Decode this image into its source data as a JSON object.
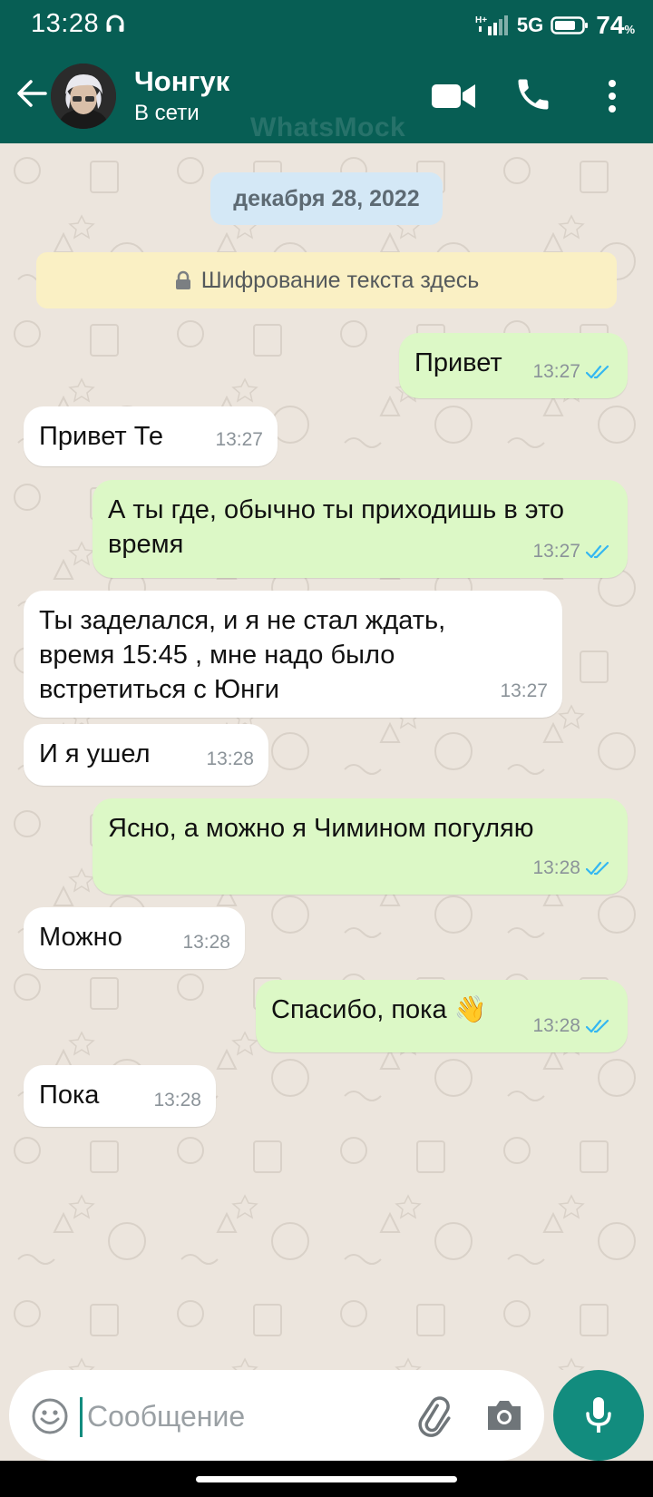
{
  "status_bar": {
    "time": "13:28",
    "network": "5G",
    "network_sub": "H+",
    "battery_pct": "74",
    "battery_pct_sign": "%"
  },
  "header": {
    "contact_name": "Чонгук",
    "contact_status": "В сети",
    "watermark": "WhatsMock"
  },
  "chat": {
    "date_chip": "декабря 28, 2022",
    "encryption_banner": "Шифрование текста здесь",
    "messages": [
      {
        "direction": "out",
        "lines": [
          "Привет"
        ],
        "time": "13:27",
        "read": true
      },
      {
        "direction": "in",
        "lines": [
          "Привет Те"
        ],
        "time": "13:27"
      },
      {
        "direction": "out",
        "lines": [
          "А ты где, обычно ты приходишь в это",
          "время"
        ],
        "time": "13:27",
        "read": true
      },
      {
        "direction": "in",
        "lines": [
          "Ты заделался, и я не стал ждать,",
          "время 15:45 , мне надо было",
          "встретиться с Юнги"
        ],
        "time": "13:27"
      },
      {
        "direction": "in",
        "lines": [
          "И я ушел"
        ],
        "time": "13:28"
      },
      {
        "direction": "out",
        "lines": [
          "Ясно, а можно я Чимином погуляю"
        ],
        "time": "13:28",
        "read": true
      },
      {
        "direction": "in",
        "lines": [
          "Можно"
        ],
        "time": "13:28"
      },
      {
        "direction": "out",
        "lines": [
          "Спасибо, пока 👋"
        ],
        "time": "13:28",
        "read": true
      },
      {
        "direction": "in",
        "lines": [
          "Пока"
        ],
        "time": "13:28"
      }
    ]
  },
  "input_bar": {
    "placeholder": "Сообщение",
    "value": ""
  },
  "colors": {
    "header": "#075E54",
    "accent": "#128C7E",
    "outgoing_bubble": "#DCF8C6",
    "incoming_bubble": "#FFFFFF",
    "chat_background": "#ECE5DD",
    "read_ticks": "#34B7F1"
  },
  "icons": {
    "back": "back-arrow-icon",
    "video": "video-camera-icon",
    "call": "phone-icon",
    "menu": "more-vert-icon",
    "lock": "lock-icon",
    "ticks": "double-check-icon",
    "emoji": "emoji-icon",
    "attach": "paperclip-icon",
    "camera": "camera-icon",
    "mic": "microphone-icon"
  }
}
